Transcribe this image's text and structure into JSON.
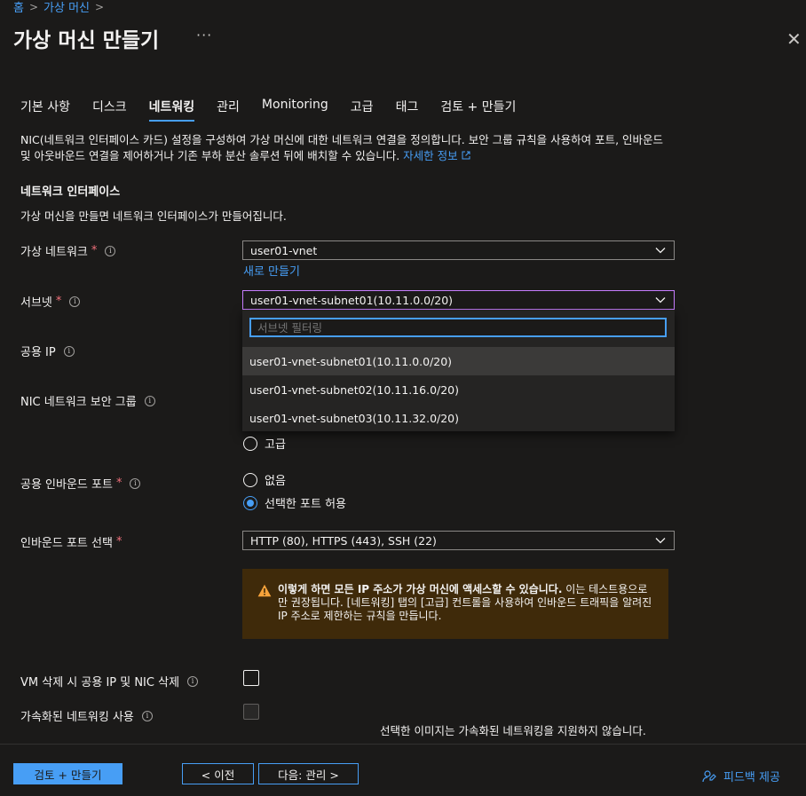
{
  "breadcrumb": [
    "홈",
    "가상 머신"
  ],
  "title": "가상 머신 만들기",
  "more": "···",
  "close": "✕",
  "tabs": [
    "기본 사항",
    "디스크",
    "네트워킹",
    "관리",
    "Monitoring",
    "고급",
    "태그",
    "검토 + 만들기"
  ],
  "active_tab": 2,
  "description": {
    "text": "NIC(네트워크 인터페이스 카드) 설정을 구성하여 가상 머신에 대한 네트워크 연결을 정의합니다. 보안 그룹 규칙을 사용하여 포트, 인바운드 및 아웃바운드 연결을 제어하거나 기존 부하 분산 솔루션 뒤에 배치할 수 있습니다.",
    "link": "자세한 정보"
  },
  "section": {
    "title": "네트워크 인터페이스",
    "description": "가상 머신을 만들면 네트워크 인터페이스가 만들어집니다."
  },
  "vnet": {
    "label": "가상 네트워크",
    "value": "user01-vnet",
    "create_new": "새로 만들기"
  },
  "subnet": {
    "label": "서브넷",
    "value": "user01-vnet-subnet01(10.11.0.0/20)",
    "filter_placeholder": "서브넷 필터링",
    "options": [
      "user01-vnet-subnet01(10.11.0.0/20)",
      "user01-vnet-subnet02(10.11.16.0/20)",
      "user01-vnet-subnet03(10.11.32.0/20)"
    ]
  },
  "public_ip": {
    "label": "공용 IP"
  },
  "nsg": {
    "label": "NIC 네트워크 보안 그룹",
    "option_advanced": "고급"
  },
  "inbound": {
    "label": "공용 인바운드 포트",
    "option_none": "없음",
    "option_allow": "선택한 포트 허용"
  },
  "inbound_select": {
    "label": "인바운드 포트 선택",
    "value": "HTTP (80), HTTPS (443), SSH (22)"
  },
  "warning": {
    "bold": "이렇게 하면 모든 IP 주소가 가상 머신에 액세스할 수 있습니다.",
    "text": " 이는 테스트용으로만 권장됩니다. [네트워킹] 탭의 [고급] 컨트롤을 사용하여 인바운드 트래픽을 알려진 IP 주소로 제한하는 규칙을 만듭니다."
  },
  "delete_option": {
    "label": "VM 삭제 시 공용 IP 및 NIC 삭제"
  },
  "accel": {
    "label": "가속화된 네트워킹 사용",
    "note": "선택한 이미지는 가속화된 네트워킹을 지원하지 않습니다."
  },
  "footer": {
    "review": "검토 + 만들기",
    "prev": "< 이전",
    "next": "다음: 관리 >",
    "feedback": "피드백 제공"
  },
  "colors": {
    "accent": "#479ef5",
    "background": "#1b1a19",
    "warning_bg": "#3f2a0a",
    "required": "#f1707b"
  }
}
